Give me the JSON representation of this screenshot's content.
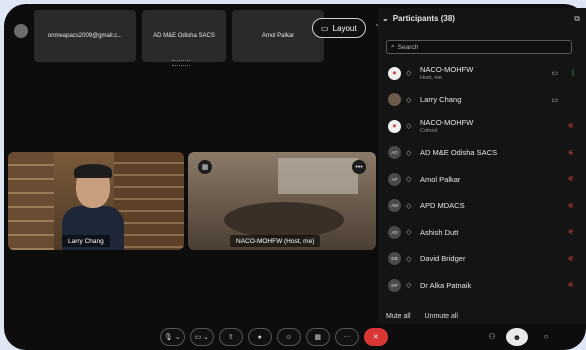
{
  "thumbnails": [
    {
      "label": "onmeapacs2009@gmail.c..."
    },
    {
      "label": "AD M&E Odisha SACS"
    },
    {
      "label": "Amol Palkar"
    }
  ],
  "layout_button": {
    "label": "Layout"
  },
  "video_tiles": [
    {
      "label": "Larry Chang"
    },
    {
      "label": "NACO-MOHFW (Host, me)"
    }
  ],
  "participants_panel": {
    "title": "Participants (38)",
    "search_placeholder": "Search",
    "participants": [
      {
        "name": "NACO-MOHFW",
        "role": "Host, me",
        "avatar": "logo",
        "video": true,
        "mic": "on"
      },
      {
        "name": "Larry Chang",
        "role": "",
        "avatar": "photo",
        "video": true,
        "mic": ""
      },
      {
        "name": "NACO-MOHFW",
        "role": "Cohost",
        "avatar": "logo",
        "video": false,
        "mic": "muted"
      },
      {
        "name": "AD M&E Odisha SACS",
        "role": "",
        "avatar": "AO",
        "video": false,
        "mic": "muted"
      },
      {
        "name": "Amol Palkar",
        "role": "",
        "avatar": "AP",
        "video": false,
        "mic": "muted"
      },
      {
        "name": "APD MDACS",
        "role": "",
        "avatar": "AM",
        "video": false,
        "mic": "muted"
      },
      {
        "name": "Ashish Dutt",
        "role": "",
        "avatar": "AD",
        "video": false,
        "mic": "muted"
      },
      {
        "name": "David Bridger",
        "role": "",
        "avatar": "DB",
        "video": false,
        "mic": "muted"
      },
      {
        "name": "Dr Alka Patnaik",
        "role": "",
        "avatar": "DP",
        "video": false,
        "mic": "muted"
      }
    ],
    "mute_all": "Mute all",
    "unmute_all": "Unmute all"
  },
  "colors": {
    "end_call": "#d93636",
    "mic_muted": "#e04545",
    "mic_on": "#3fb34f"
  }
}
